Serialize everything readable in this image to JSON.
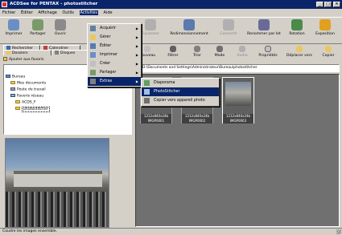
{
  "window": {
    "title": "ACDSee for PENTAX - photostitcher",
    "minimize": "_",
    "maximize": "□",
    "close": "×"
  },
  "menubar": [
    "Fichier",
    "Éditer",
    "Affichage",
    "Outils",
    "Activités",
    "Aide"
  ],
  "toolbar": {
    "left": [
      {
        "label": "Imprimer",
        "icon": "printer-icon",
        "color": "#6a8fc4"
      },
      {
        "label": "Partager",
        "icon": "share-icon",
        "color": "#7a9a6a"
      },
      {
        "label": "Ouvrir",
        "icon": "open-icon",
        "color": "#8a8a8a"
      }
    ],
    "right": [
      {
        "label": "Fusionner",
        "icon": "merge-icon",
        "color": "#a0a0a0",
        "disabled": true
      },
      {
        "label": "Redimensionnement",
        "icon": "resize-icon",
        "color": "#5a7ab0"
      },
      {
        "label": "Convertir",
        "icon": "convert-icon",
        "color": "#a0a0a0",
        "disabled": true
      },
      {
        "label": "Renommer par lot",
        "icon": "rename-icon",
        "color": "#6a6a9a"
      },
      {
        "label": "Rotation",
        "icon": "rotate-icon",
        "color": "#4a8a4a"
      },
      {
        "label": "Exposition",
        "icon": "exposure-icon",
        "color": "#e0a020"
      }
    ]
  },
  "toolbar2": [
    {
      "label": "Nouveau",
      "icon": "new-icon"
    },
    {
      "label": "Filtrer",
      "icon": "filter-icon"
    },
    {
      "label": "Trier",
      "icon": "sort-icon"
    },
    {
      "label": "Mode",
      "icon": "mode-icon"
    },
    {
      "label": "Audio",
      "icon": "audio-icon",
      "disabled": true
    },
    {
      "label": "Propriétés",
      "icon": "properties-icon"
    },
    {
      "label": "Déplacer vers",
      "icon": "move-to-icon"
    },
    {
      "label": "Copier",
      "icon": "copy-icon"
    }
  ],
  "tabs": [
    {
      "label": "Rechercher",
      "icon": "search-icon"
    },
    {
      "label": "Calendrier",
      "icon": "calendar-icon"
    },
    {
      "label": "Dossiers",
      "icon": "folders-icon"
    },
    {
      "label": "Disques",
      "icon": "disks-icon"
    }
  ],
  "favorites": {
    "add_label": "Ajouter aux favoris"
  },
  "tree": [
    {
      "label": "Bureau",
      "indent": 0
    },
    {
      "label": "Mes documents",
      "indent": 1
    },
    {
      "label": "Poste de travail",
      "indent": 1
    },
    {
      "label": "Favoris réseau",
      "indent": 1
    },
    {
      "label": "ACDS_F",
      "indent": 1
    },
    {
      "label": "photostitcher",
      "indent": 1
    }
  ],
  "path": "D:\\Documents and Settings\\Administrateur\\Bureau\\photostitcher",
  "thumbnails": [
    {
      "dims": "1212x840x24b",
      "name": "IMGP0001"
    },
    {
      "dims": "1212x840x24b",
      "name": "IMGP0002"
    },
    {
      "dims": "1212x840x24b",
      "name": "IMGP0003"
    }
  ],
  "activities_menu": [
    {
      "label": "Acquérir",
      "icon": "acquire-icon",
      "submenu": true
    },
    {
      "label": "Gérer",
      "icon": "manage-icon",
      "submenu": true
    },
    {
      "label": "Éditer",
      "icon": "edit-icon",
      "submenu": true
    },
    {
      "label": "Imprimer",
      "icon": "print-icon",
      "submenu": true
    },
    {
      "label": "Créer",
      "icon": "create-icon",
      "submenu": true
    },
    {
      "label": "Partager",
      "icon": "share-icon",
      "submenu": true
    },
    {
      "label": "Extras",
      "icon": "extras-icon",
      "submenu": true,
      "selected": true
    }
  ],
  "extras_submenu": [
    {
      "label": "Diaporama",
      "icon": "slideshow-icon"
    },
    {
      "label": "PhotoStitcher",
      "icon": "photostitcher-icon",
      "selected": true
    },
    {
      "label": "Copier vers appareil photo",
      "icon": "camera-copy-icon"
    }
  ],
  "status": "Coudre les images ensemble.",
  "colors": {
    "titlebar": "#0a246a",
    "selection": "#0a246a",
    "face": "#d4d0c8"
  }
}
